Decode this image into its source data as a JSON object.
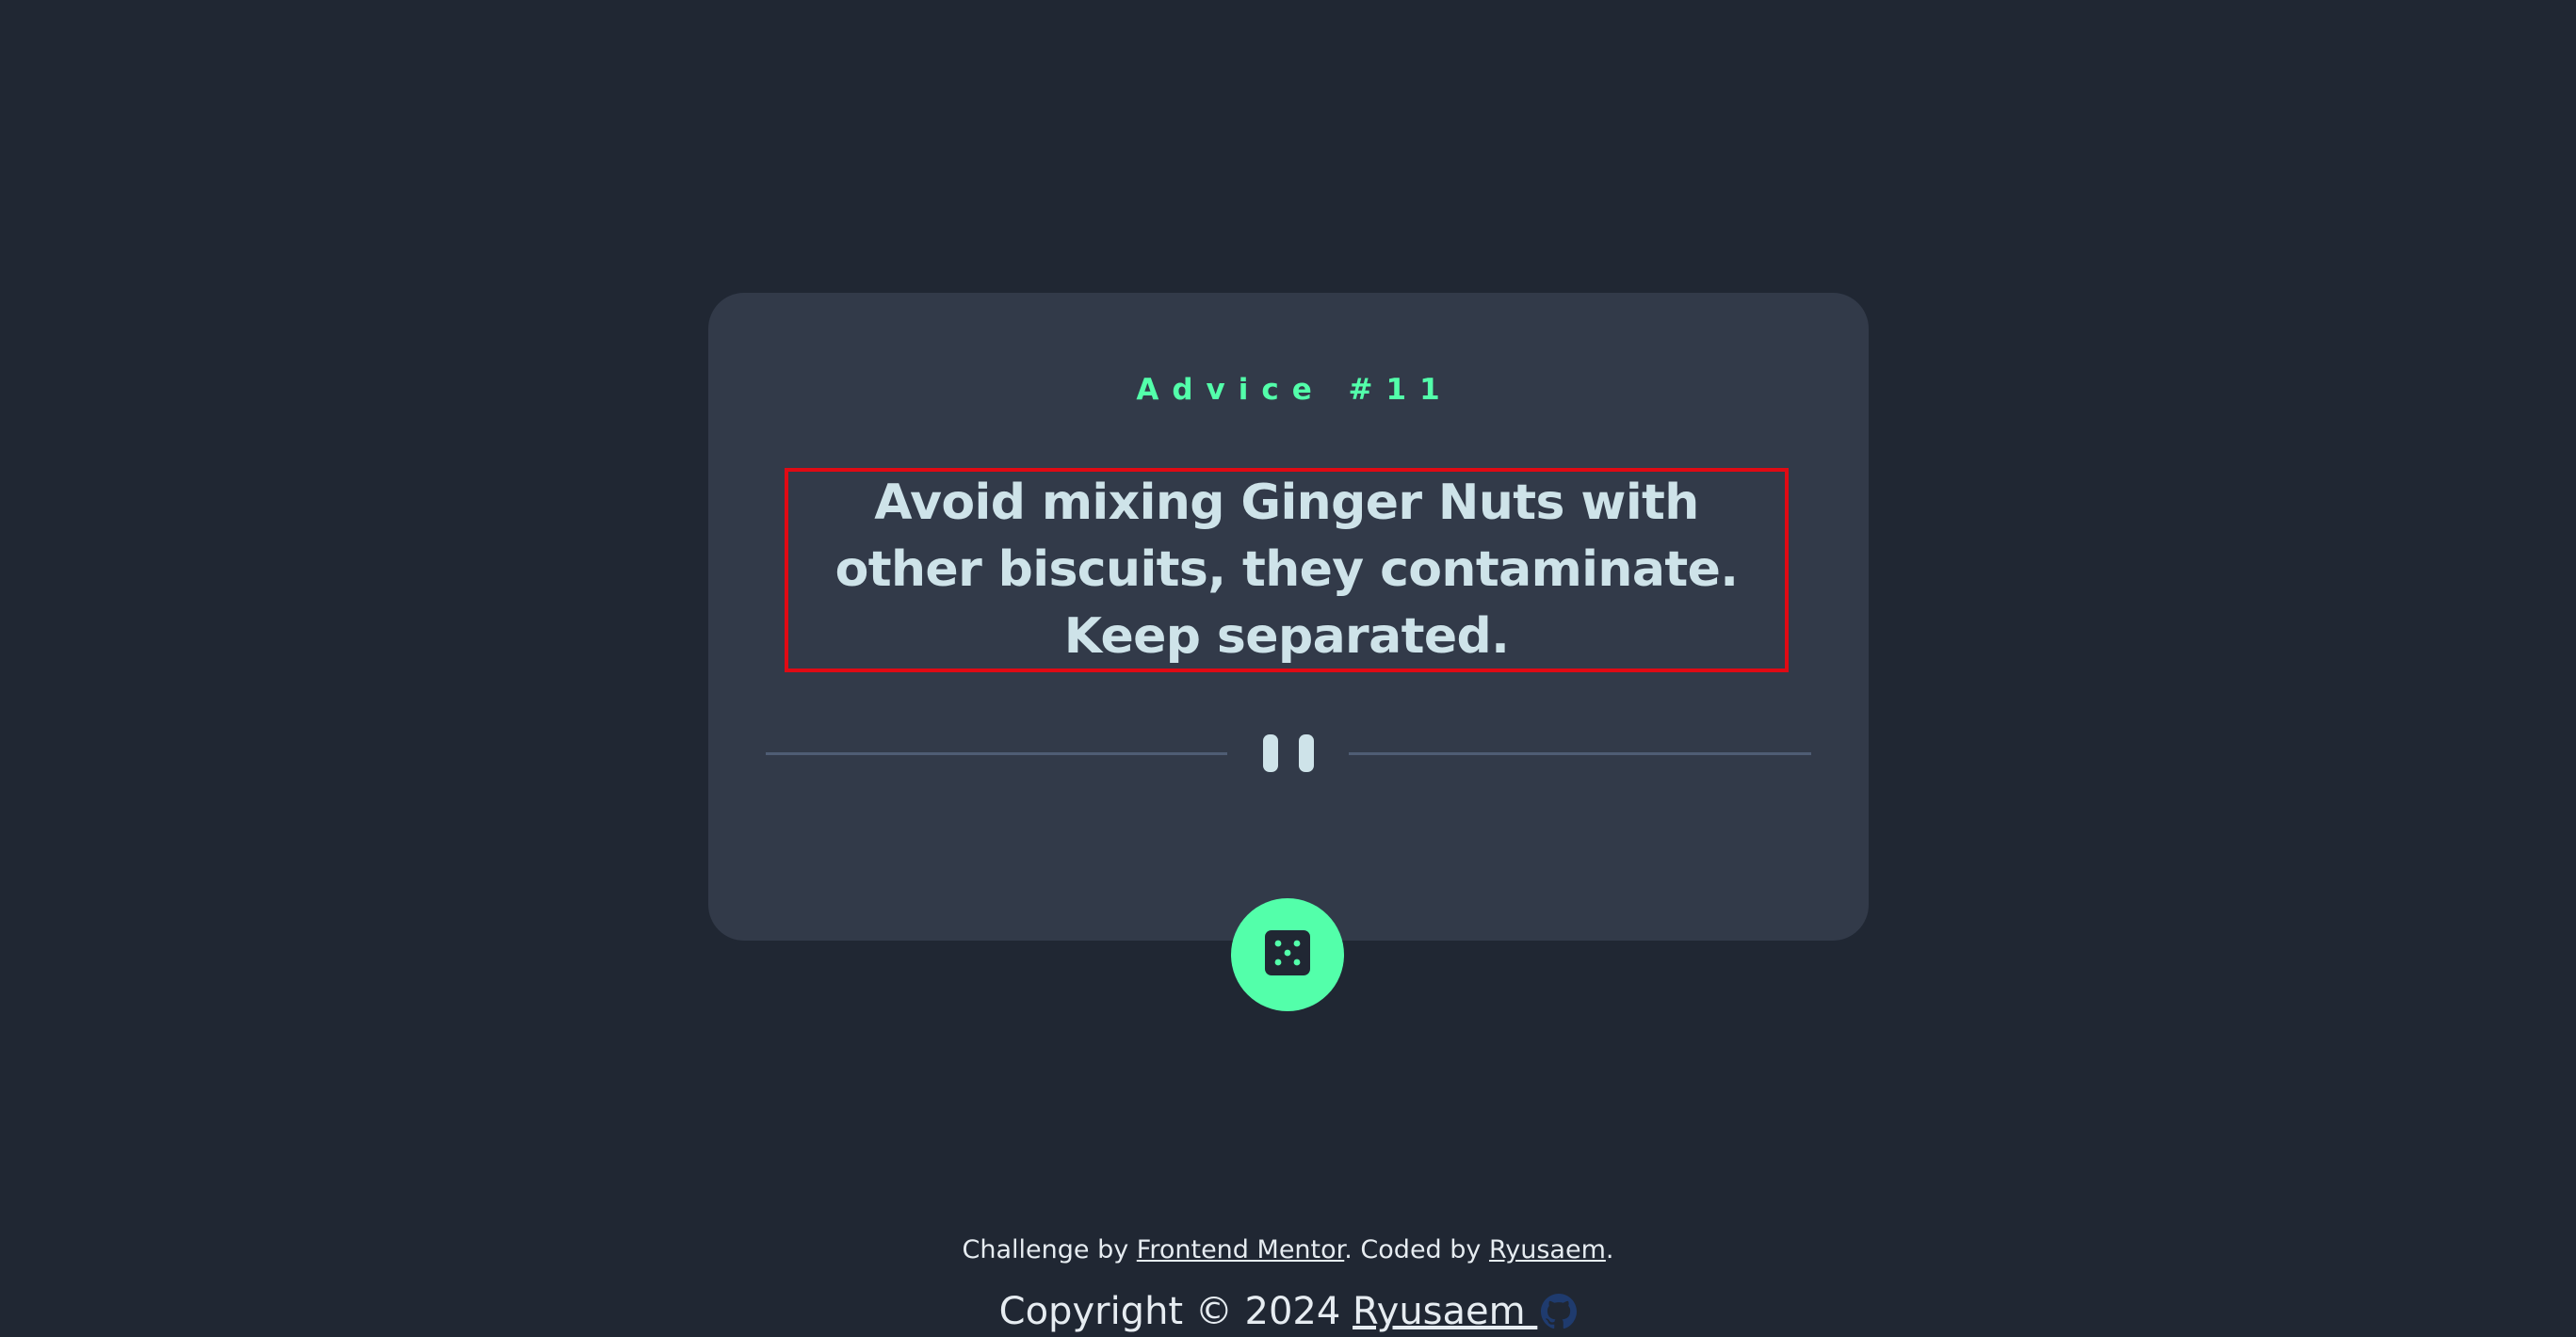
{
  "advice": {
    "id_label": "Advice #11",
    "quote": "Avoid mixing Ginger Nuts with other biscuits, they contaminate. Keep separated."
  },
  "icons": {
    "divider": "pause-icon",
    "button": "dice-icon",
    "github": "github-icon"
  },
  "colors": {
    "accent": "#53FFAA",
    "background": "#202733",
    "card": "#323A49",
    "text": "#CEE3E9",
    "highlight_border": "#E00A14"
  },
  "footer": {
    "challenge_prefix": "Challenge by ",
    "challenge_link": "Frontend Mentor",
    "coded_prefix": ". Coded by ",
    "coded_link": "Ryusaem",
    "coded_suffix": ".",
    "copyright_prefix": "Copyright © 2024 ",
    "copyright_link": "Ryusaem "
  }
}
